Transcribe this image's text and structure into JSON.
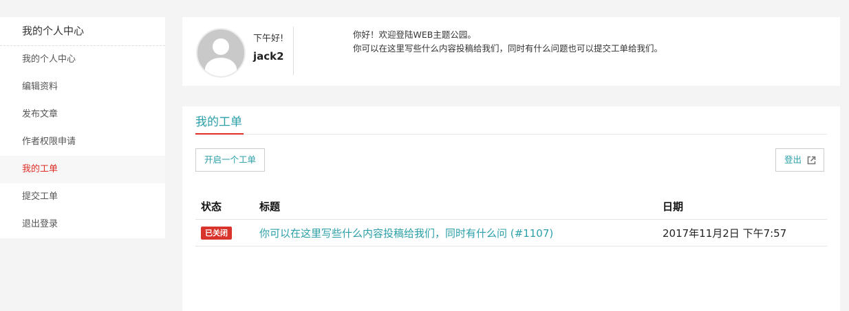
{
  "sidebar": {
    "title": "我的个人中心",
    "items": [
      {
        "label": "我的个人中心"
      },
      {
        "label": "编辑资料"
      },
      {
        "label": "发布文章"
      },
      {
        "label": "作者权限申请"
      },
      {
        "label": "我的工单"
      },
      {
        "label": "提交工单"
      },
      {
        "label": "退出登录"
      }
    ],
    "active_color": "#e02d25"
  },
  "profile": {
    "greeting": "下午好!",
    "username": "jack2",
    "welcome_line1": "你好！欢迎登陆WEB主题公园。",
    "welcome_line2": "你可以在这里写些什么内容投稿给我们，同时有什么问题也可以提交工单给我们。",
    "avatar_icon": "default-user-avatar"
  },
  "tickets": {
    "tab_label": "我的工单",
    "new_button_label": "开启一个工单",
    "logout_button_label": "登出",
    "logout_icon": "external-link-icon",
    "columns": [
      "状态",
      "标题",
      "日期"
    ],
    "rows": [
      {
        "status": "已关闭",
        "title": "你可以在这里写些什么内容投稿给我们，同时有什么问 (#1107)",
        "date": "2017年11月2日 下午7:57"
      }
    ],
    "accent_color": "#2a9fa8",
    "status_closed_color": "#d9342b"
  }
}
